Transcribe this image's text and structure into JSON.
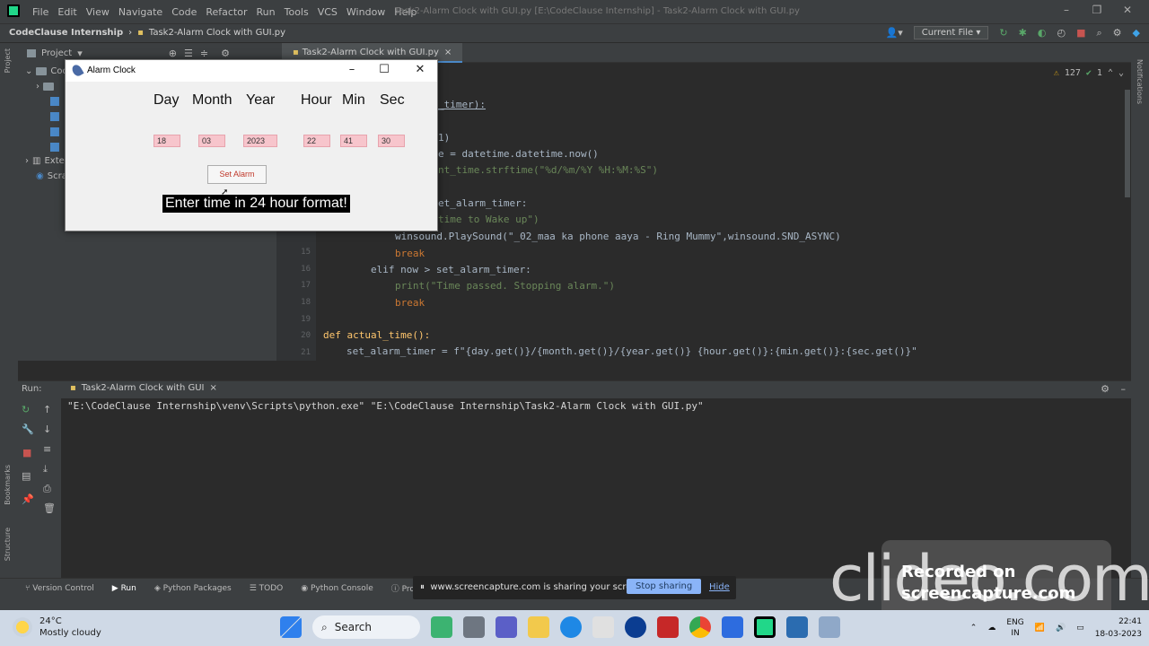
{
  "menubar": {
    "menus": [
      "File",
      "Edit",
      "View",
      "Navigate",
      "Code",
      "Refactor",
      "Run",
      "Tools",
      "VCS",
      "Window",
      "Help"
    ],
    "title": "Task2-Alarm Clock with GUI.py [E:\\CodeClause Internship] - Task2-Alarm Clock with GUI.py"
  },
  "navbar": {
    "project": "CodeClause Internship",
    "file": "Task2-Alarm Clock with GUI.py",
    "run_config": "Current File"
  },
  "project_panel": {
    "title": "Project",
    "root": "Cod",
    "ext": "Exte",
    "scratch": "Scra"
  },
  "editor": {
    "tab": "Task2-Alarm Clock with GUI.py",
    "warnings": "127",
    "checks": "1"
  },
  "code": [
    {
      "n": "",
      "t": "_timer):"
    },
    {
      "n": "",
      "t": "1)"
    },
    {
      "n": "",
      "t": "e = datetime.datetime.now()"
    },
    {
      "n": "",
      "t": "nt_time.strftime(\"%d/%m/%Y %H:%M:%S\")"
    },
    {
      "n": "",
      "t": "et_alarm_timer:"
    },
    {
      "n": "",
      "t": "time to Wake up\")"
    },
    {
      "n": "",
      "t": "winsound.PlaySound(\"_02_maa ka phone aaya - Ring Mummy\",winsound.SND_ASYNC)"
    },
    {
      "n": "15",
      "t": "break"
    },
    {
      "n": "16",
      "t": "elif now > set_alarm_timer:"
    },
    {
      "n": "17",
      "t": "print(\"Time passed. Stopping alarm.\")"
    },
    {
      "n": "18",
      "t": "break"
    },
    {
      "n": "19",
      "t": ""
    },
    {
      "n": "20",
      "t": "def actual_time():"
    },
    {
      "n": "21",
      "t": "set_alarm_timer = f\"{day.get()}/{month.get()}/{year.get()} {hour.get()}:{min.get()}:{sec.get()}\""
    }
  ],
  "run": {
    "label": "Run:",
    "tab": "Task2-Alarm Clock with GUI",
    "output": "\"E:\\CodeClause Internship\\venv\\Scripts\\python.exe\" \"E:\\CodeClause Internship\\Task2-Alarm Clock with GUI.py\""
  },
  "bottombar": [
    "Version Control",
    "Run",
    "Python Packages",
    "TODO",
    "Python Console",
    "Problem"
  ],
  "share": {
    "message": "www.screencapture.com is sharing your screen.",
    "stop": "Stop sharing",
    "hide": "Hide"
  },
  "watermark": {
    "big": "clideo.com",
    "line1": "Recorded on",
    "line2": "screencapture.com"
  },
  "dialog": {
    "title": "Alarm Clock",
    "labels": [
      "Day",
      "Month",
      "Year",
      "Hour",
      "Min",
      "Sec"
    ],
    "values": [
      "18",
      "03",
      "2023",
      "22",
      "41",
      "30"
    ],
    "button": "Set Alarm",
    "message": "Enter time in 24 hour format!"
  },
  "taskbar": {
    "temp": "24°C",
    "weather": "Mostly cloudy",
    "search": "Search",
    "lang1": "ENG",
    "lang2": "IN",
    "time": "22:41",
    "date": "18-03-2023"
  }
}
